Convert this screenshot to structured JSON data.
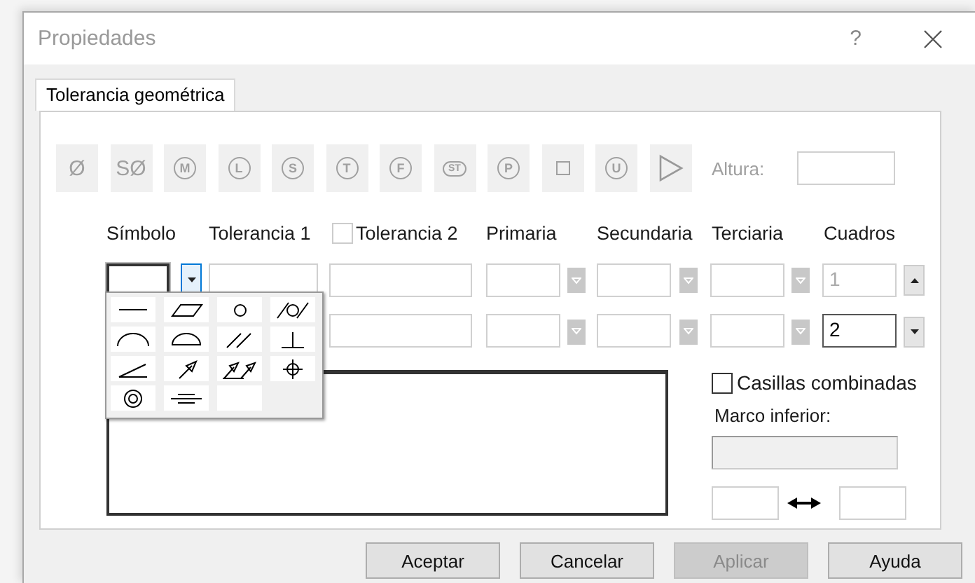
{
  "window": {
    "title": "Propiedades",
    "help": "?"
  },
  "tabs": [
    {
      "label": "Tolerancia geométrica",
      "selected": true
    }
  ],
  "symbol_bar": {
    "disabled": true,
    "buttons": [
      {
        "kind": "text",
        "label": "Ø"
      },
      {
        "kind": "text",
        "label": "SØ"
      },
      {
        "kind": "circled",
        "label": "M"
      },
      {
        "kind": "circled",
        "label": "L"
      },
      {
        "kind": "circled",
        "label": "S"
      },
      {
        "kind": "circled",
        "label": "T"
      },
      {
        "kind": "circled",
        "label": "F"
      },
      {
        "kind": "hexagon",
        "label": "ST"
      },
      {
        "kind": "circled",
        "label": "P"
      },
      {
        "kind": "square"
      },
      {
        "kind": "circled",
        "label": "U"
      },
      {
        "kind": "triangle"
      }
    ]
  },
  "height": {
    "label": "Altura:"
  },
  "headers": [
    {
      "label": "Símbolo"
    },
    {
      "label": "Tolerancia 1"
    },
    {
      "label": "Tolerancia 2",
      "checked": false
    },
    {
      "label": "Primaria"
    },
    {
      "label": "Secundaria"
    },
    {
      "label": "Terciaria"
    },
    {
      "label": "Cuadros"
    }
  ],
  "rows": [
    {
      "symbol_focused": true,
      "cuadros": "1",
      "cuadros_active": false,
      "spin_up": true
    },
    {
      "cuadros": "2",
      "cuadros_active": true,
      "spin_up": false
    }
  ],
  "symbol_menu": {
    "open": true,
    "items": [
      {
        "kind": "straightness"
      },
      {
        "kind": "flatness"
      },
      {
        "kind": "circularity"
      },
      {
        "kind": "cylindricity"
      },
      {
        "kind": "line_profile"
      },
      {
        "kind": "surface_profile"
      },
      {
        "kind": "parallelism"
      },
      {
        "kind": "perpendicularity"
      },
      {
        "kind": "angularity"
      },
      {
        "kind": "circular_runout"
      },
      {
        "kind": "total_runout"
      },
      {
        "kind": "position"
      },
      {
        "kind": "concentricity"
      },
      {
        "kind": "symmetry"
      },
      {
        "kind": "none"
      }
    ]
  },
  "combined": {
    "label": "Casillas combinadas",
    "checked": false
  },
  "lower_frame": {
    "label": "Marco inferior:",
    "disabled": true
  },
  "buttons": [
    {
      "label": "Aceptar",
      "disabled": false
    },
    {
      "label": "Cancelar",
      "disabled": false
    },
    {
      "label": "Aplicar",
      "disabled": true
    },
    {
      "label": "Ayuda",
      "disabled": false
    }
  ]
}
